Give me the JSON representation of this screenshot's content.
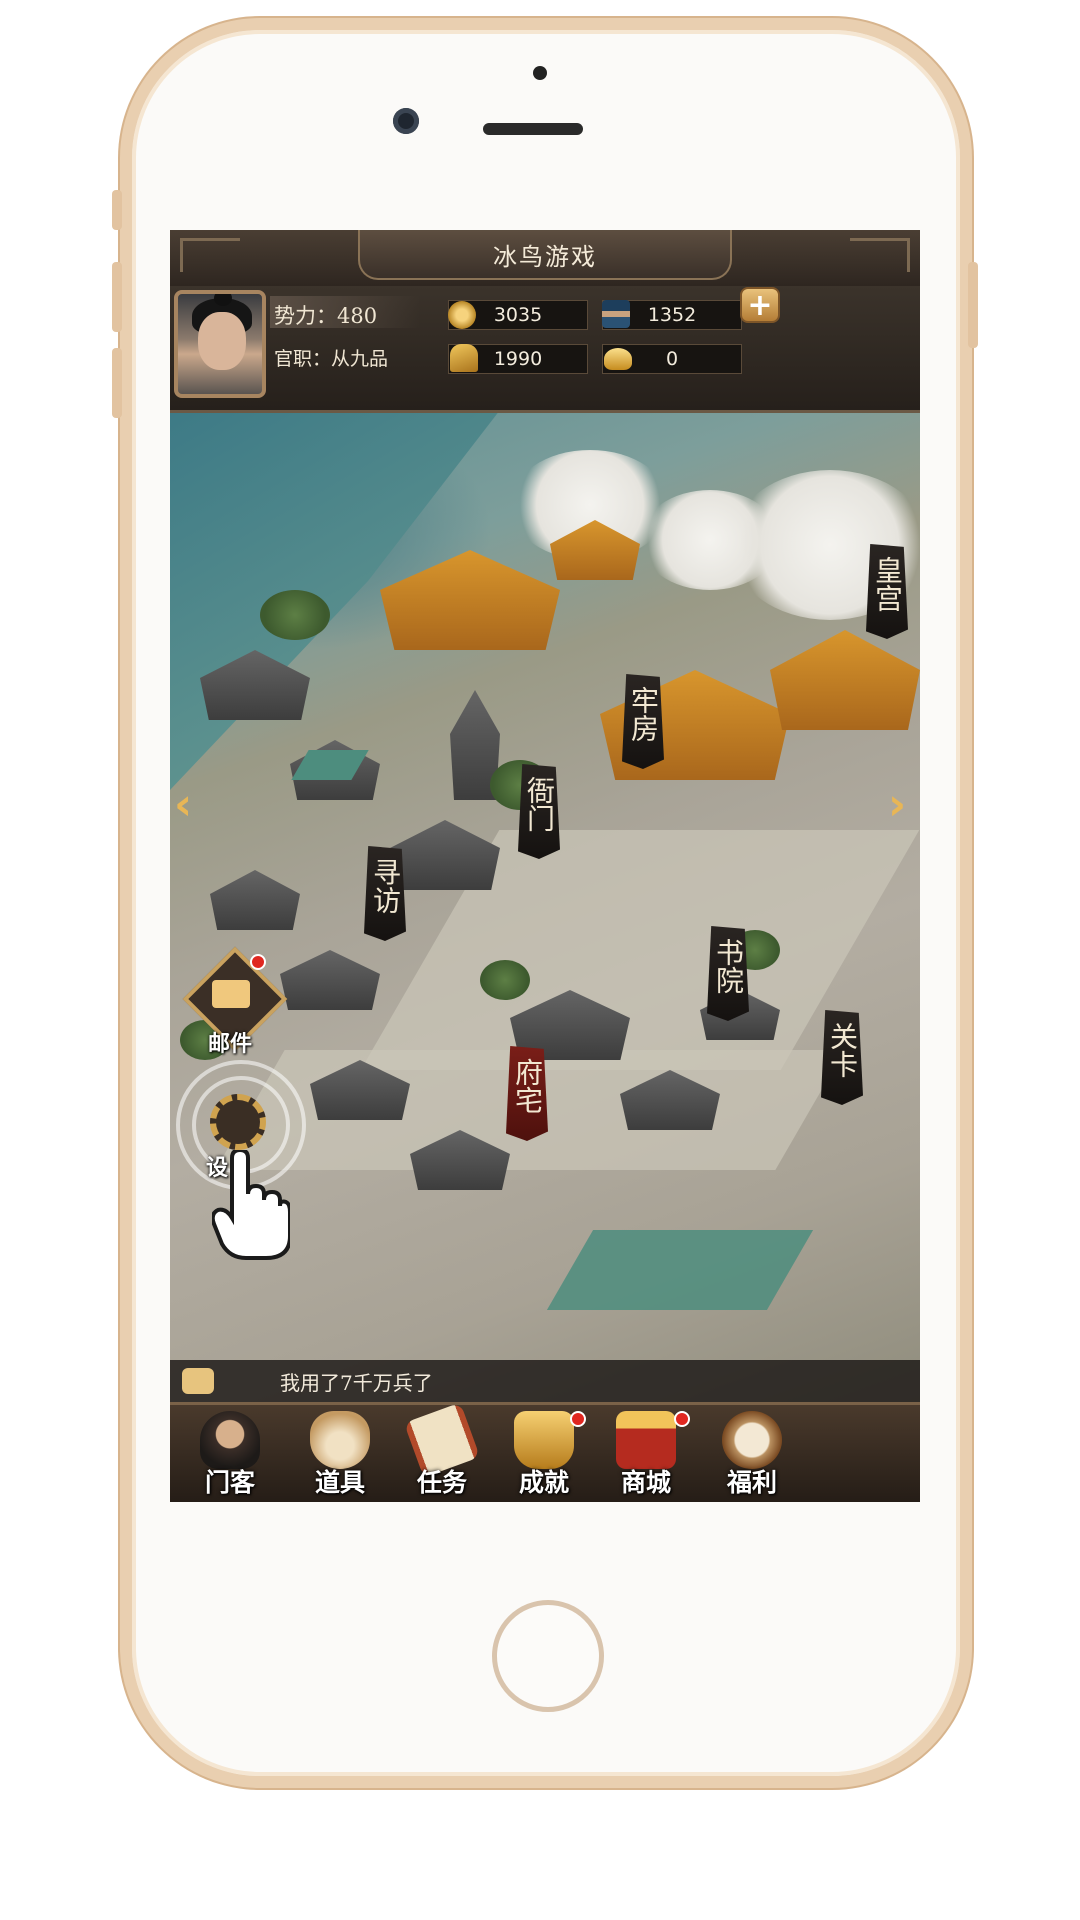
{
  "app": {
    "title": "冰鸟游戏"
  },
  "player": {
    "power_label": "势力：480",
    "rank_label": "官职：从九品"
  },
  "resources": {
    "coins": "3035",
    "soldiers": "1352",
    "grain": "1990",
    "gold": "0",
    "add_label": "+"
  },
  "map": {
    "places": [
      "皇宫",
      "牢房",
      "衙门",
      "寻访",
      "书院",
      "关卡",
      "府宅"
    ]
  },
  "side": {
    "mail_label": "邮件",
    "settings_label": "设"
  },
  "chat": {
    "message": "我用了7千万兵了"
  },
  "tabs": [
    {
      "label": "门客"
    },
    {
      "label": "道具"
    },
    {
      "label": "任务"
    },
    {
      "label": "成就"
    },
    {
      "label": "商城"
    },
    {
      "label": "福利"
    }
  ],
  "colors": {
    "frame": "#e9cfb0",
    "panel": "#2e2620",
    "accent": "#d0a34f",
    "badge": "#e02720"
  }
}
